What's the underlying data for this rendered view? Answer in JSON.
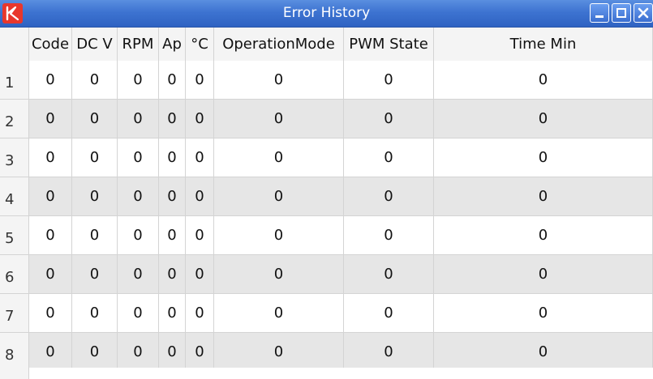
{
  "window": {
    "title": "Error History",
    "logo_icon": "app-logo-icon",
    "controls": {
      "minimize_icon": "minimize-icon",
      "maximize_icon": "maximize-icon",
      "close_icon": "close-icon"
    },
    "colors": {
      "titlebar": "#3d73d1",
      "logo": "#e8372c",
      "row_alt": "#e6e6e6"
    }
  },
  "table": {
    "columns": [
      "Code",
      "DC V",
      "RPM",
      "Ap",
      "°C",
      "OperationMode",
      "PWM State",
      "Time Min"
    ],
    "rows": [
      {
        "index": "1",
        "cells": [
          "0",
          "0",
          "0",
          "0",
          "0",
          "0",
          "0",
          "0"
        ]
      },
      {
        "index": "2",
        "cells": [
          "0",
          "0",
          "0",
          "0",
          "0",
          "0",
          "0",
          "0"
        ]
      },
      {
        "index": "3",
        "cells": [
          "0",
          "0",
          "0",
          "0",
          "0",
          "0",
          "0",
          "0"
        ]
      },
      {
        "index": "4",
        "cells": [
          "0",
          "0",
          "0",
          "0",
          "0",
          "0",
          "0",
          "0"
        ]
      },
      {
        "index": "5",
        "cells": [
          "0",
          "0",
          "0",
          "0",
          "0",
          "0",
          "0",
          "0"
        ]
      },
      {
        "index": "6",
        "cells": [
          "0",
          "0",
          "0",
          "0",
          "0",
          "0",
          "0",
          "0"
        ]
      },
      {
        "index": "7",
        "cells": [
          "0",
          "0",
          "0",
          "0",
          "0",
          "0",
          "0",
          "0"
        ]
      },
      {
        "index": "8",
        "cells": [
          "0",
          "0",
          "0",
          "0",
          "0",
          "0",
          "0",
          "0"
        ]
      }
    ]
  }
}
